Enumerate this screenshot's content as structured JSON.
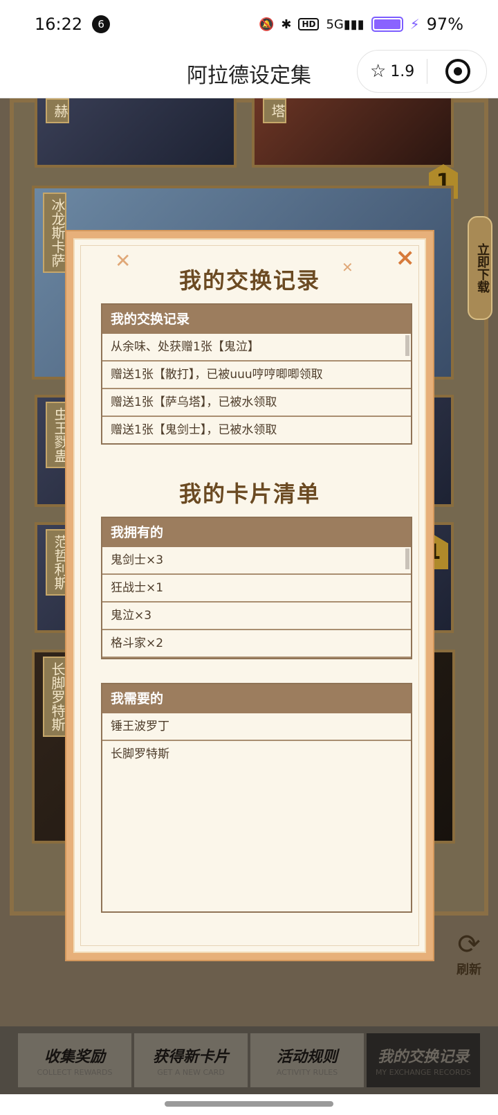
{
  "status_bar": {
    "time": "16:22",
    "notification_count": "6",
    "hd_label": "HD",
    "network_label": "5G",
    "battery_percent": "97%"
  },
  "title_bar": {
    "title": "阿拉德设定集",
    "rating": "1.9"
  },
  "background": {
    "card_labels": [
      "赫",
      "塔",
      "冰龙斯卡萨",
      "虫王戮蛊",
      "范哲利斯",
      "长脚罗特斯"
    ],
    "badge_count": "1",
    "download_label": "立即下载",
    "refresh_label": "刷新"
  },
  "bottom_nav": [
    {
      "zh": "收集奖励",
      "en": "COLLECT REWARDS"
    },
    {
      "zh": "获得新卡片",
      "en": "GET A NEW CARD"
    },
    {
      "zh": "活动规则",
      "en": "ACTIVITY RULES"
    },
    {
      "zh": "我的交换记录",
      "en": "MY EXCHANGE RECORDS"
    }
  ],
  "modal": {
    "heading_records": "我的交换记录",
    "records_panel_title": "我的交换记录",
    "records": [
      "从余味、处获赠1张【鬼泣】",
      "赠送1张【散打】，已被uuu哼哼唧唧领取",
      "赠送1张【萨乌塔】，已被水领取",
      "赠送1张【鬼剑士】，已被水领取"
    ],
    "heading_cards": "我的卡片清单",
    "owned_panel_title": "我拥有的",
    "owned": [
      "鬼剑士×3",
      "狂战士×1",
      "鬼泣×3",
      "格斗家×2"
    ],
    "needed_panel_title": "我需要的",
    "needed": [
      "锤王波罗丁",
      "长脚罗特斯"
    ],
    "close_label": "×"
  }
}
